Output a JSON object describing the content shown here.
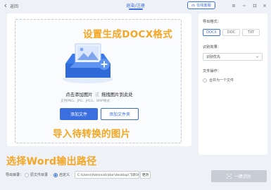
{
  "titlebar": {
    "back_label": "返回",
    "title": "退染/注册",
    "sample_label": "在线客服"
  },
  "dropzone": {
    "drop_text_1": "点击添加图片",
    "drop_sep": "或",
    "drop_text_2": "拖拽图片到此处",
    "supported_formats": "支持PNG、JPG、JPEG、BMP格式",
    "add_file_label": "添加文件",
    "add_folder_label": "添加文件夹"
  },
  "annotations": {
    "set_format": "设置生成DOCX格式",
    "import_images": "导入待转换的图片",
    "choose_output": "选择Word输出路径"
  },
  "settings": {
    "format_label": "导出格式：",
    "formats": [
      "DOCX",
      "DOC",
      "TXT"
    ],
    "selected_format": "DOCX",
    "recognition_label": "识别效果：",
    "recognition_value": "识别优先",
    "file_ops_label": "文件操作：",
    "merge_label": "合并为一个文件"
  },
  "output": {
    "label": "导出目录：",
    "option_original": "原文件目录",
    "option_custom": "自定义",
    "selected": "自定义",
    "path": "C:\\Users\\Administrator\\desktop\\飞转OCR识别",
    "change_label": "更改",
    "convert_label": "一键识别"
  },
  "colors": {
    "accent": "#3b6fe0",
    "annotation": "#f5a623",
    "disabled_button": "#c7ccd5"
  }
}
